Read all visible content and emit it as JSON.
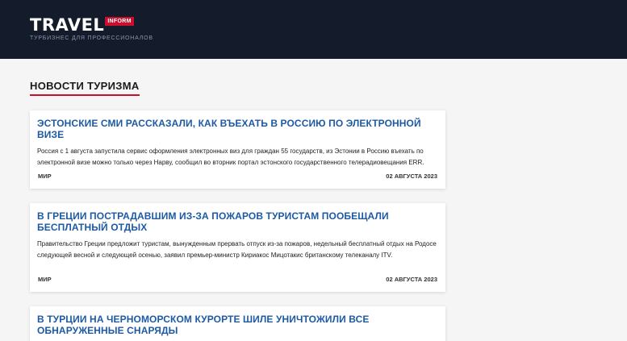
{
  "header": {
    "logo_text": "TRAVEL",
    "logo_badge": "INFORM",
    "tagline": "Турбизнес для профессионалов",
    "background": "#141b2b",
    "accent": "#c8102e"
  },
  "section": {
    "title": "НОВОСТИ ТУРИЗМА"
  },
  "news": [
    {
      "title": "Эстонские СМИ рассказали, как въехать в Россию по электронной визе",
      "text": "Россия с 1 августа запустила сервис оформления электронных виз для граждан 55 государств, из Эстонии в Россию въехать по электронной визе можно только через Нарву, сообщил во вторник портал эстонского государственного телерадиовещания ERR.",
      "category": "МИР",
      "date": "02 АВГУСТА 2023"
    },
    {
      "title": "В Греции пострадавшим из-за пожаров туристам пообещали бесплатный отдых",
      "text": "Правительство Греции предложит туристам, вынужденным прервать отпуск из-за пожаров, недельный бесплатный отдых на Родосе следующей весной и следующей осенью, заявил премьер-министр Кириакос Мицотакис британскому телеканалу ITV.",
      "category": "МИР",
      "date": "02 АВГУСТА 2023"
    },
    {
      "title": "В Турции на черноморском курорте Шиле уничтожили все обнаруженные снаряды"
    }
  ]
}
